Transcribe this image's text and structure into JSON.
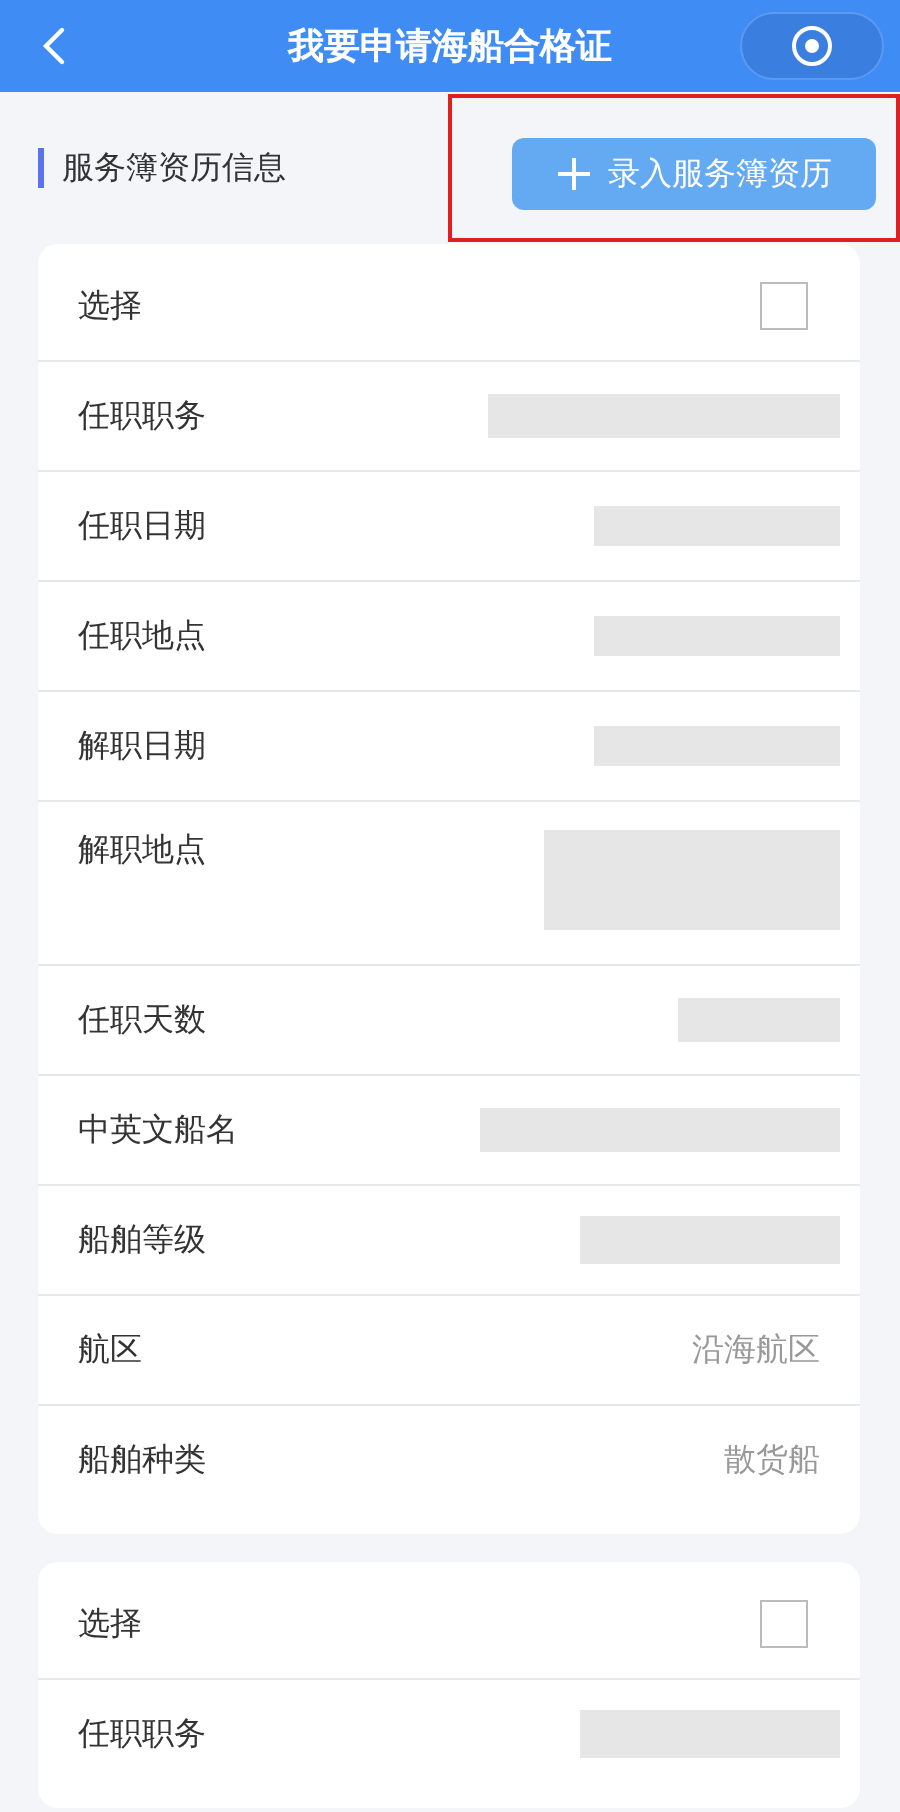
{
  "header": {
    "title": "我要申请海船合格证"
  },
  "section": {
    "title": "服务簿资历信息",
    "add_button": {
      "label": "录入服务簿资历",
      "highlighted": true
    }
  },
  "cards": [
    {
      "rows": [
        {
          "kind": "checkbox",
          "label": "选择",
          "checked": false
        },
        {
          "kind": "redacted",
          "label": "任职职务"
        },
        {
          "kind": "redacted",
          "label": "任职日期"
        },
        {
          "kind": "redacted",
          "label": "任职地点"
        },
        {
          "kind": "redacted",
          "label": "解职日期"
        },
        {
          "kind": "redacted",
          "label": "解职地点"
        },
        {
          "kind": "redacted",
          "label": "任职天数"
        },
        {
          "kind": "redacted",
          "label": "中英文船名"
        },
        {
          "kind": "redacted",
          "label": "船舶等级"
        },
        {
          "kind": "text",
          "label": "航区",
          "value": "沿海航区"
        },
        {
          "kind": "text",
          "label": "船舶种类",
          "value": "散货船"
        }
      ]
    },
    {
      "rows": [
        {
          "kind": "checkbox",
          "label": "选择",
          "checked": false
        },
        {
          "kind": "redacted",
          "label": "任职职务"
        }
      ]
    }
  ]
}
